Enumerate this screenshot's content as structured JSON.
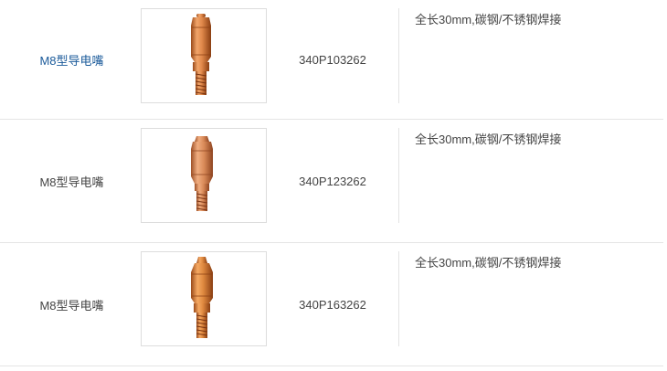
{
  "products": [
    {
      "name": "M8型导电嘴",
      "code": "340P103262",
      "description": "全长30mm,碳钢/不锈钢焊接",
      "image_icon": "contact-tip-image",
      "name_is_link": true
    },
    {
      "name": "M8型导电嘴",
      "code": "340P123262",
      "description": "全长30mm,碳钢/不锈钢焊接",
      "image_icon": "contact-tip-image",
      "name_is_link": false
    },
    {
      "name": "M8型导电嘴",
      "code": "340P163262",
      "description": "全长30mm,碳钢/不锈钢焊接",
      "image_icon": "contact-tip-image",
      "name_is_link": false
    }
  ],
  "colors": {
    "link": "#1a5a9a",
    "text": "#444444",
    "copper_light": "#f2a56a",
    "copper_mid": "#d9783a",
    "copper_dark": "#9a4a1a",
    "border": "#dddddd"
  }
}
